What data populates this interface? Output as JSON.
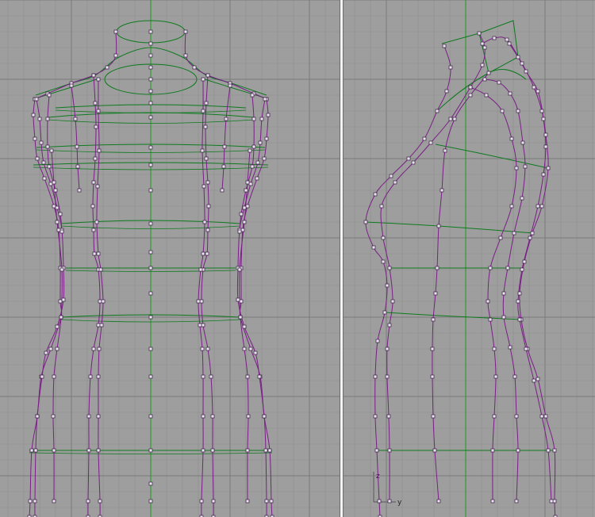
{
  "viewports": [
    {
      "id": "front"
    },
    {
      "id": "right"
    }
  ],
  "colors": {
    "background": "#9e9e9e",
    "grid_minor": "#8e8e8e",
    "grid_major": "#7a7a7a",
    "curve": "#7a1f86",
    "section": "#0d7a1e",
    "axis": "#1a9a1a",
    "point_fill": "#e9e3ee",
    "point_stroke": "#3a1d44",
    "splitter": "#f4f4f4"
  },
  "axis_widget": {
    "vertical_label": "z",
    "horizontal_label": "y"
  }
}
